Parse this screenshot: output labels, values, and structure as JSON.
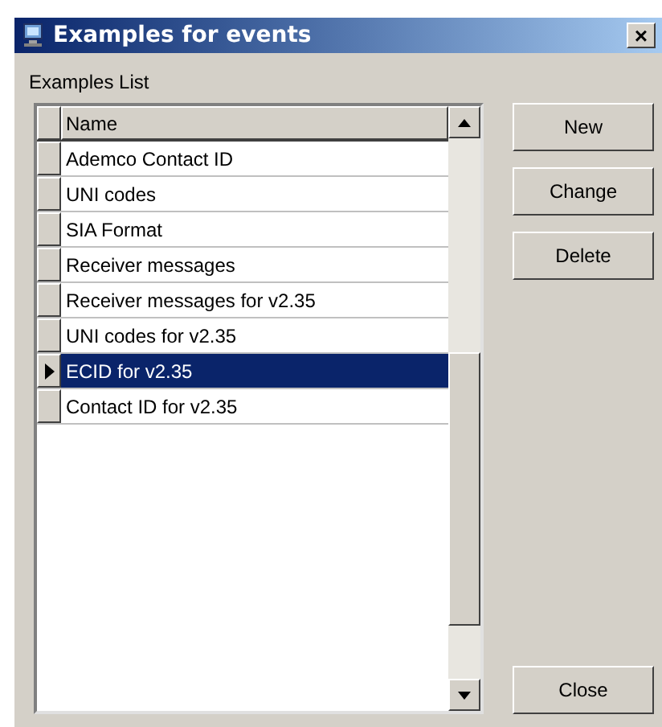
{
  "window": {
    "title": "Examples for events",
    "close": "×"
  },
  "list_label": "Examples List",
  "grid": {
    "columns": [
      "Name"
    ],
    "rows": [
      {
        "name": "Ademco Contact ID",
        "selected": false
      },
      {
        "name": "UNI codes",
        "selected": false
      },
      {
        "name": "SIA Format",
        "selected": false
      },
      {
        "name": "Receiver messages",
        "selected": false
      },
      {
        "name": "Receiver messages for v2.35",
        "selected": false
      },
      {
        "name": "UNI codes for v2.35",
        "selected": false
      },
      {
        "name": "ECID for v2.35",
        "selected": true
      },
      {
        "name": "Contact ID for v2.35",
        "selected": false
      }
    ]
  },
  "buttons": [
    "New",
    "Change",
    "Delete"
  ],
  "close_button": "Close"
}
